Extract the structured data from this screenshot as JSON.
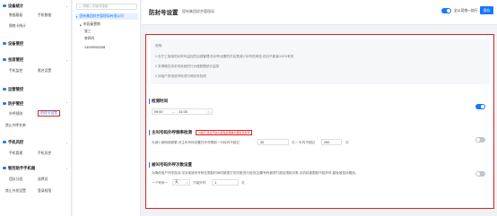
{
  "nav": {
    "groups": [
      {
        "title": "设备统计",
        "items": [
          "数据看板",
          "手机数据",
          "隔夜卡统计"
        ]
      },
      {
        "title": "设备管控"
      },
      {
        "title": "坐席管控",
        "items": [
          "手机监控",
          "黑名设置"
        ]
      },
      {
        "title": "运营管控"
      },
      {
        "title": "防护管控",
        "items": [
          "外呼规则",
          "防封号设置",
          "禁止外呼名单"
        ]
      },
      {
        "title": "手机风控",
        "items": [
          "手机管理",
          "手机风控"
        ]
      },
      {
        "title": "智控助手手机端",
        "items": [
          "团队分组",
          "选择员",
          "禁止外发设置",
          "登录权限"
        ]
      }
    ],
    "active_item": "防封号设置"
  },
  "tree": {
    "search_placeholder": "请输入关键词搜索",
    "root": "国有集团综合管理局有限公司",
    "children": [
      "市区级营销",
      "张三",
      "李四丹",
      "13099990258"
    ]
  },
  "header": {
    "title": "防封号设置",
    "subtitle": "国有集团综合管理局",
    "toggle_label": "全公司统一执行",
    "toggle_on": true,
    "save_label": "保存"
  },
  "notice": {
    "title": "说明:",
    "lines": [
      "1.也于工信部的对呼叫监控的加强管理,防封号设置的开启是减少封号的风险,但并不能保100%有效",
      "2.本策略支持手机系统的行为做数据统计监测",
      "3.对客户的电信号码进行风险号检测"
    ]
  },
  "sections": {
    "check_time": {
      "title": "检测时间",
      "start": "09:00",
      "sep": "—",
      "end": "21:00",
      "enabled": true
    },
    "call_freq": {
      "title": "主叫号码外呼频率检测",
      "badge": "小提示:建议开启以避免坐席被大量投诉封号",
      "desc": "为减少被网络频繁,对主叫号码设置在外呼限制一分钟内不超过",
      "val1": "30",
      "mid": "次,一天内不超过",
      "val2": "200",
      "unit": "次",
      "enabled": false
    },
    "callee_limit": {
      "title": "被叫号码外呼次数设置",
      "desc": "为降低用户外呼投诉,仅对某被叫号码在限制时间内被拨打的次数进行检测,如果号码被拨打超出限制次数,手机将被限制不能外呼,避免被投诉骚扰。",
      "prefix": "一个号码一",
      "period": "天",
      "mid": "只能外呼",
      "count": "1",
      "unit": "次",
      "enabled": false
    }
  },
  "colors": {
    "accent": "#1677ff",
    "highlight": "#e02020"
  }
}
